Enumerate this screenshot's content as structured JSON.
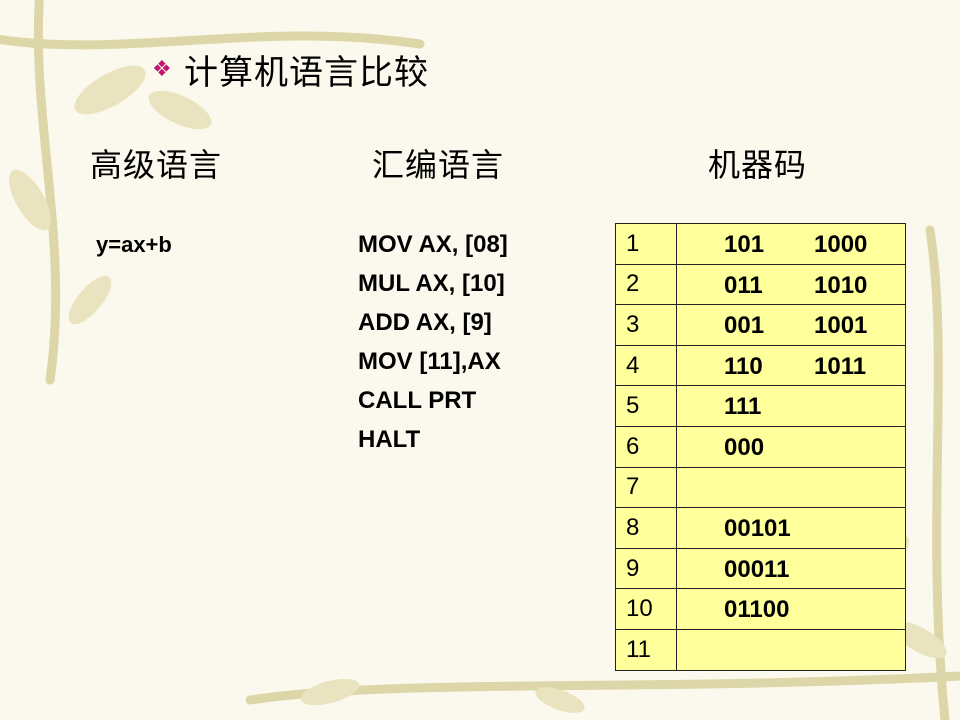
{
  "title": "计算机语言比较",
  "bullet": "❖",
  "columns": {
    "high_level": "高级语言",
    "assembly": "汇编语言",
    "machine": "机器码"
  },
  "high_level_code": "y=ax+b",
  "assembly_code": [
    "MOV AX, [08]",
    "MUL AX, [10]",
    "ADD AX, [9]",
    "MOV [11],AX",
    "CALL PRT",
    "HALT"
  ],
  "memory_table": [
    {
      "addr": "1",
      "op": "101",
      "val": "1000"
    },
    {
      "addr": "2",
      "op": "011",
      "val": "1010"
    },
    {
      "addr": "3",
      "op": "001",
      "val": "1001"
    },
    {
      "addr": "4",
      "op": "110",
      "val": "1011"
    },
    {
      "addr": "5",
      "op": "111",
      "val": ""
    },
    {
      "addr": "6",
      "op": "000",
      "val": ""
    },
    {
      "addr": "7",
      "op": "",
      "val": ""
    },
    {
      "addr": "8",
      "op": "00101",
      "val": ""
    },
    {
      "addr": "9",
      "op": "00011",
      "val": ""
    },
    {
      "addr": "10",
      "op": "01100",
      "val": ""
    },
    {
      "addr": "11",
      "op": "",
      "val": ""
    }
  ],
  "colors": {
    "bullet": "#c0186e",
    "table_fill": "#ffff9c",
    "background": "#fbf9ee"
  }
}
